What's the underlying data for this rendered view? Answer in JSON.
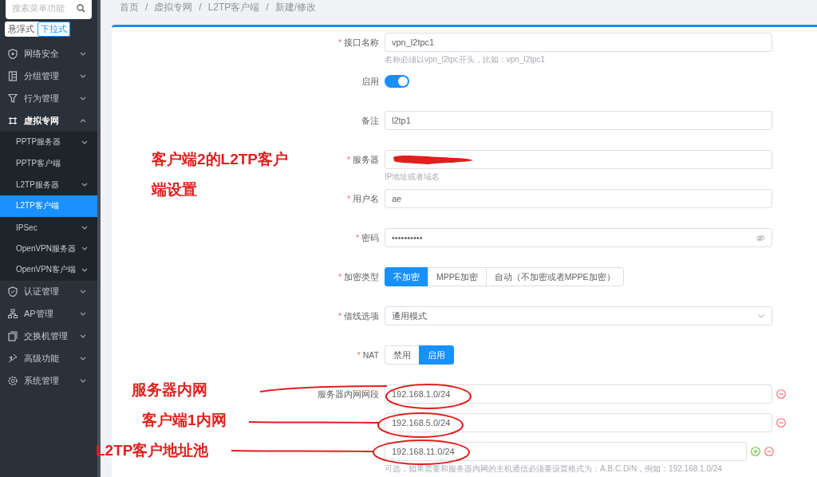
{
  "sidebar": {
    "search": {
      "placeholder": "搜索菜单功能"
    },
    "mode_toggle": [
      {
        "label": "悬浮式",
        "selected": false
      },
      {
        "label": "下拉式",
        "selected": true
      }
    ],
    "items": [
      {
        "label": "网络安全",
        "expanded": false
      },
      {
        "label": "分组管理",
        "expanded": false
      },
      {
        "label": "行为管理",
        "expanded": false
      },
      {
        "label": "虚拟专网",
        "expanded": true,
        "children": [
          {
            "label": "PPTP服务器",
            "kind": "group",
            "selected": false
          },
          {
            "label": "PPTP客户端",
            "kind": "link",
            "selected": false
          },
          {
            "label": "L2TP服务器",
            "kind": "group",
            "selected": false
          },
          {
            "label": "L2TP客户端",
            "kind": "link",
            "selected": true
          },
          {
            "label": "IPSec",
            "kind": "group",
            "selected": false
          },
          {
            "label": "OpenVPN服务器",
            "kind": "group",
            "selected": false
          },
          {
            "label": "OpenVPN客户端",
            "kind": "group",
            "selected": false
          }
        ]
      },
      {
        "label": "认证管理",
        "expanded": false
      },
      {
        "label": "AP管理",
        "expanded": false
      },
      {
        "label": "交换机管理",
        "expanded": false
      },
      {
        "label": "高级功能",
        "expanded": false
      },
      {
        "label": "系统管理",
        "expanded": false
      }
    ]
  },
  "breadcrumb": {
    "separator": "/",
    "items": [
      "首页",
      "虚拟专网",
      "L2TP客户端",
      "新建/修改"
    ]
  },
  "form": {
    "required_mark": "*",
    "fields": [
      {
        "kind": "input",
        "label": "接口名称",
        "required": true,
        "value": "vpn_l2tpc1",
        "hint": "名称必须以vpn_l2tpc开头，比如：vpn_l2tpc1"
      },
      {
        "kind": "switch",
        "label": "启用",
        "required": false,
        "on": true
      },
      {
        "kind": "input",
        "label": "备注",
        "required": false,
        "value": "l2tp1"
      },
      {
        "kind": "input",
        "label": "服务器",
        "required": true,
        "redacted": true,
        "hint": "IP地址或者域名"
      },
      {
        "kind": "input",
        "label": "用户名",
        "required": true,
        "value": "ae"
      },
      {
        "kind": "password",
        "label": "密码",
        "required": true,
        "value": "••••••••••"
      },
      {
        "kind": "segmented",
        "label": "加密类型",
        "required": true,
        "options": [
          {
            "label": "不加密",
            "selected": true
          },
          {
            "label": "MPPE加密",
            "selected": false
          },
          {
            "label": "自动（不加密或者MPPE加密）",
            "selected": false
          }
        ]
      },
      {
        "kind": "select",
        "label": "借线选项",
        "required": true,
        "value": "通用模式"
      },
      {
        "kind": "segmented",
        "label": "NAT",
        "required": true,
        "options": [
          {
            "label": "禁用",
            "selected": false
          },
          {
            "label": "启用",
            "selected": true
          }
        ]
      },
      {
        "kind": "multi",
        "label": "服务器内网网段",
        "required": false,
        "values": [
          "192.168.1.0/24",
          "192.168.5.0/24",
          "192.168.11.0/24"
        ],
        "hint": "可选，如果需要和服务器内网的主机通信必须要设置格式为：A.B.C.D/N，例如：192.168.1.0/24"
      }
    ]
  },
  "annotations": [
    {
      "text": "客户端2的L2TP客户端设置"
    },
    {
      "text": "服务器内网"
    },
    {
      "text": "客户端1内网"
    },
    {
      "text": "L2TP客户地址池"
    }
  ]
}
